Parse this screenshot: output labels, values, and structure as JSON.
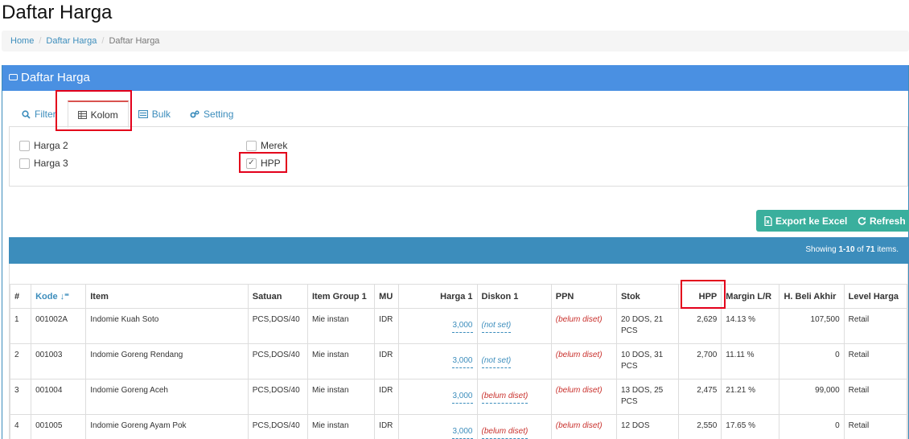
{
  "page_title": "Daftar Harga",
  "breadcrumb": [
    "Home",
    "Daftar Harga",
    "Daftar Harga"
  ],
  "panel_title": "Daftar Harga",
  "tabs": [
    {
      "label": "Filter",
      "icon": "search-icon"
    },
    {
      "label": "Kolom",
      "icon": "table-icon"
    },
    {
      "label": "Bulk",
      "icon": "list-icon"
    },
    {
      "label": "Setting",
      "icon": "gears-icon"
    }
  ],
  "columns_options": [
    {
      "label": "Harga 2",
      "checked": false
    },
    {
      "label": "Harga 3",
      "checked": false
    },
    {
      "label": "Merek",
      "checked": false
    },
    {
      "label": "HPP",
      "checked": true
    }
  ],
  "buttons": {
    "export": "Export ke Excel",
    "refresh": "Refresh"
  },
  "summary": {
    "prefix": "Showing ",
    "range": "1-10",
    "of": " of ",
    "total": "71",
    "suffix": " items."
  },
  "table": {
    "headers": [
      "#",
      "Kode",
      "Item",
      "Satuan",
      "Item Group 1",
      "MU",
      "Harga 1",
      "Diskon 1",
      "PPN",
      "Stok",
      "HPP",
      "Margin L/R",
      "H. Beli Akhir",
      "Level Harga"
    ],
    "rows": [
      {
        "no": "1",
        "kode": "001002A",
        "item": "Indomie Kuah Soto",
        "satuan": "PCS,DOS/40",
        "group": "Mie instan",
        "mu": "IDR",
        "harga1": "3,000",
        "diskon": "(not set)",
        "ppn": "(belum diset)",
        "stok": "20 DOS, 21 PCS",
        "hpp": "2,629",
        "margin": "14.13 %",
        "beli": "107,500",
        "level": "Retail"
      },
      {
        "no": "2",
        "kode": "001003",
        "item": "Indomie Goreng Rendang",
        "satuan": "PCS,DOS/40",
        "group": "Mie instan",
        "mu": "IDR",
        "harga1": "3,000",
        "diskon": "(not set)",
        "ppn": "(belum diset)",
        "stok": "10 DOS, 31 PCS",
        "hpp": "2,700",
        "margin": "11.11 %",
        "beli": "0",
        "level": "Retail"
      },
      {
        "no": "3",
        "kode": "001004",
        "item": "Indomie Goreng Aceh",
        "satuan": "PCS,DOS/40",
        "group": "Mie instan",
        "mu": "IDR",
        "harga1": "3,000",
        "diskon": "(belum diset)",
        "ppn": "(belum diset)",
        "stok": "13 DOS, 25 PCS",
        "hpp": "2,475",
        "margin": "21.21 %",
        "beli": "99,000",
        "level": "Retail"
      },
      {
        "no": "4",
        "kode": "001005",
        "item": "Indomie Goreng Ayam Pok",
        "satuan": "PCS,DOS/40",
        "group": "Mie instan",
        "mu": "IDR",
        "harga1": "3,000",
        "diskon": "(belum diset)",
        "ppn": "(belum diset)",
        "stok": "12 DOS",
        "hpp": "2,550",
        "margin": "17.65 %",
        "beli": "0",
        "level": "Retail"
      }
    ]
  },
  "colors": {
    "header_blue": "#4a90e2",
    "accent": "#3c8dbc",
    "button": "#3aaf9d",
    "highlight": "#e3001b",
    "unset": "#c9302c"
  }
}
